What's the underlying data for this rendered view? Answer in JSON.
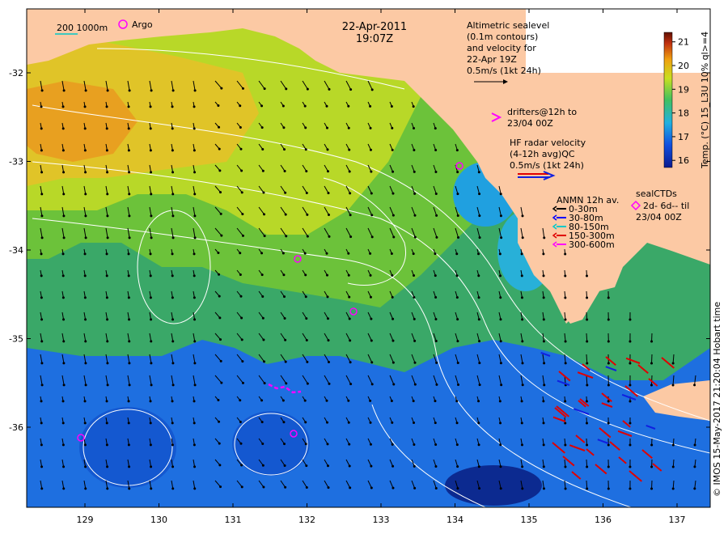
{
  "header": {
    "date": "22-Apr-2011",
    "time": "19:07Z"
  },
  "bathymetry_legend": {
    "label": "200  1000m",
    "argo_label": "Argo"
  },
  "altimetry_note": {
    "lines": [
      "Altimetric sealevel",
      "(0.1m contours)",
      "and velocity for",
      "22-Apr 19Z",
      "0.5m/s (1kt 24h)"
    ]
  },
  "drifters_note": {
    "lines": [
      "drifters@12h to",
      "23/04 00Z"
    ]
  },
  "hf_radar_note": {
    "lines": [
      "HF radar velocity",
      "(4-12h avg)QC",
      "0.5m/s (1kt 24h)"
    ]
  },
  "anmn_legend": {
    "title": "ANMN 12h av.",
    "items": [
      {
        "label": "0-30m",
        "color": "#000000"
      },
      {
        "label": "30-80m",
        "color": "#0000ff"
      },
      {
        "label": "80-150m",
        "color": "#00c8c8"
      },
      {
        "label": "150-300m",
        "color": "#e00000"
      },
      {
        "label": "300-600m",
        "color": "#ff00ff"
      }
    ]
  },
  "seal_ctd_legend": {
    "title": "sealCTDs",
    "lines": [
      "2d- 6d-- til",
      "23/04 00Z"
    ]
  },
  "colorbar": {
    "label": "Temp. (°C) 15_L3U 10% ql>=4",
    "ticks": [
      "21",
      "20",
      "19",
      "18",
      "17",
      "16"
    ],
    "range": [
      15.7,
      21.4
    ]
  },
  "axes": {
    "x_ticks": [
      "129",
      "130",
      "131",
      "132",
      "133",
      "134",
      "135",
      "136",
      "137"
    ],
    "y_ticks": [
      "-32",
      "-33",
      "-34",
      "-35",
      "-36"
    ]
  },
  "credit": "© IMOS 15-May-2017 21:20:04 Hobart time",
  "colors": {
    "land": "#fcc9a4",
    "warm_sst": "#e8b020",
    "mid_sst": "#a8d828",
    "cool_sst": "#48b048",
    "cold_sst": "#1870e0",
    "argo": "#ff00ff",
    "contour": "#ffffff"
  }
}
